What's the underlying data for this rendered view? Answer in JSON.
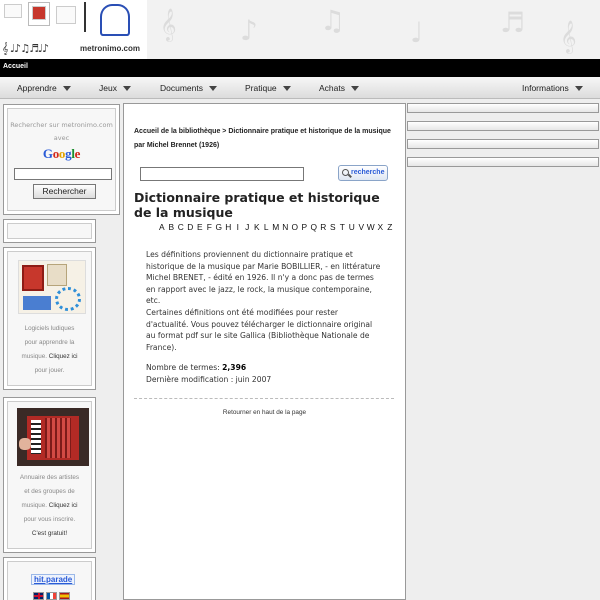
{
  "header": {
    "brand": "metronimo.com",
    "staff_glyphs": "𝄞 ♩♪♫♬♩♪"
  },
  "topbar": {
    "label": "Accueil"
  },
  "nav": {
    "items": [
      {
        "label": "Apprendre"
      },
      {
        "label": "Jeux"
      },
      {
        "label": "Documents"
      },
      {
        "label": "Pratique"
      },
      {
        "label": "Achats"
      },
      {
        "label": "Informations"
      }
    ]
  },
  "search_box": {
    "line1": "Rechercher sur metronimo.com",
    "line2": "avec",
    "google_letters": [
      "G",
      "o",
      "o",
      "g",
      "l",
      "e"
    ],
    "button": "Rechercher"
  },
  "games_box": {
    "line1": "Logiciels ludiques",
    "line2": "pour apprendre la",
    "line3_text": "musique.",
    "line3_link": "Cliquez ici",
    "line4": "pour jouer."
  },
  "artists_box": {
    "line1": "Annuaire des artistes",
    "line2": "et des groupes de",
    "line3_text": "musique.",
    "line3_link": "Cliquez ici",
    "line4": "pour vous inscrire.",
    "line5": "C'est gratuit!"
  },
  "hitparade_box": {
    "label": "hit.parade"
  },
  "main": {
    "breadcrumb_link": "Accueil de la bibliothèque",
    "breadcrumb_rest": " > Dictionnaire pratique et historique de la musique par Michel Brennet (1926)",
    "search_button": "recherche",
    "title": "Dictionnaire pratique et historique de la musique",
    "alphabet": [
      "A",
      "B",
      "C",
      "D",
      "E",
      "F",
      "G",
      "H",
      "I",
      "J",
      "K",
      "L",
      "M",
      "N",
      "O",
      "P",
      "Q",
      "R",
      "S",
      "T",
      "U",
      "V",
      "W",
      "X",
      "Z"
    ],
    "para1": "Les définitions proviennent du dictionnaire pratique et historique de la musique par Marie BOBILLIER, - en littérature Michel BRENET, - édité en 1926. Il n'y a donc pas de termes en rapport avec  le jazz, le rock, la musique contemporaine, etc.",
    "para2": "Certaines définitions ont été modifiées pour rester d'actualité. Vous pouvez télécharger le dictionnaire original au format pdf sur le site Gallica (Bibliothèque Nationale de France).",
    "terms_label": "Nombre de termes: ",
    "terms_value": "2,396",
    "modified": "Dernière modification : juin 2007",
    "back_to_top": "Retourner en haut de la page"
  }
}
